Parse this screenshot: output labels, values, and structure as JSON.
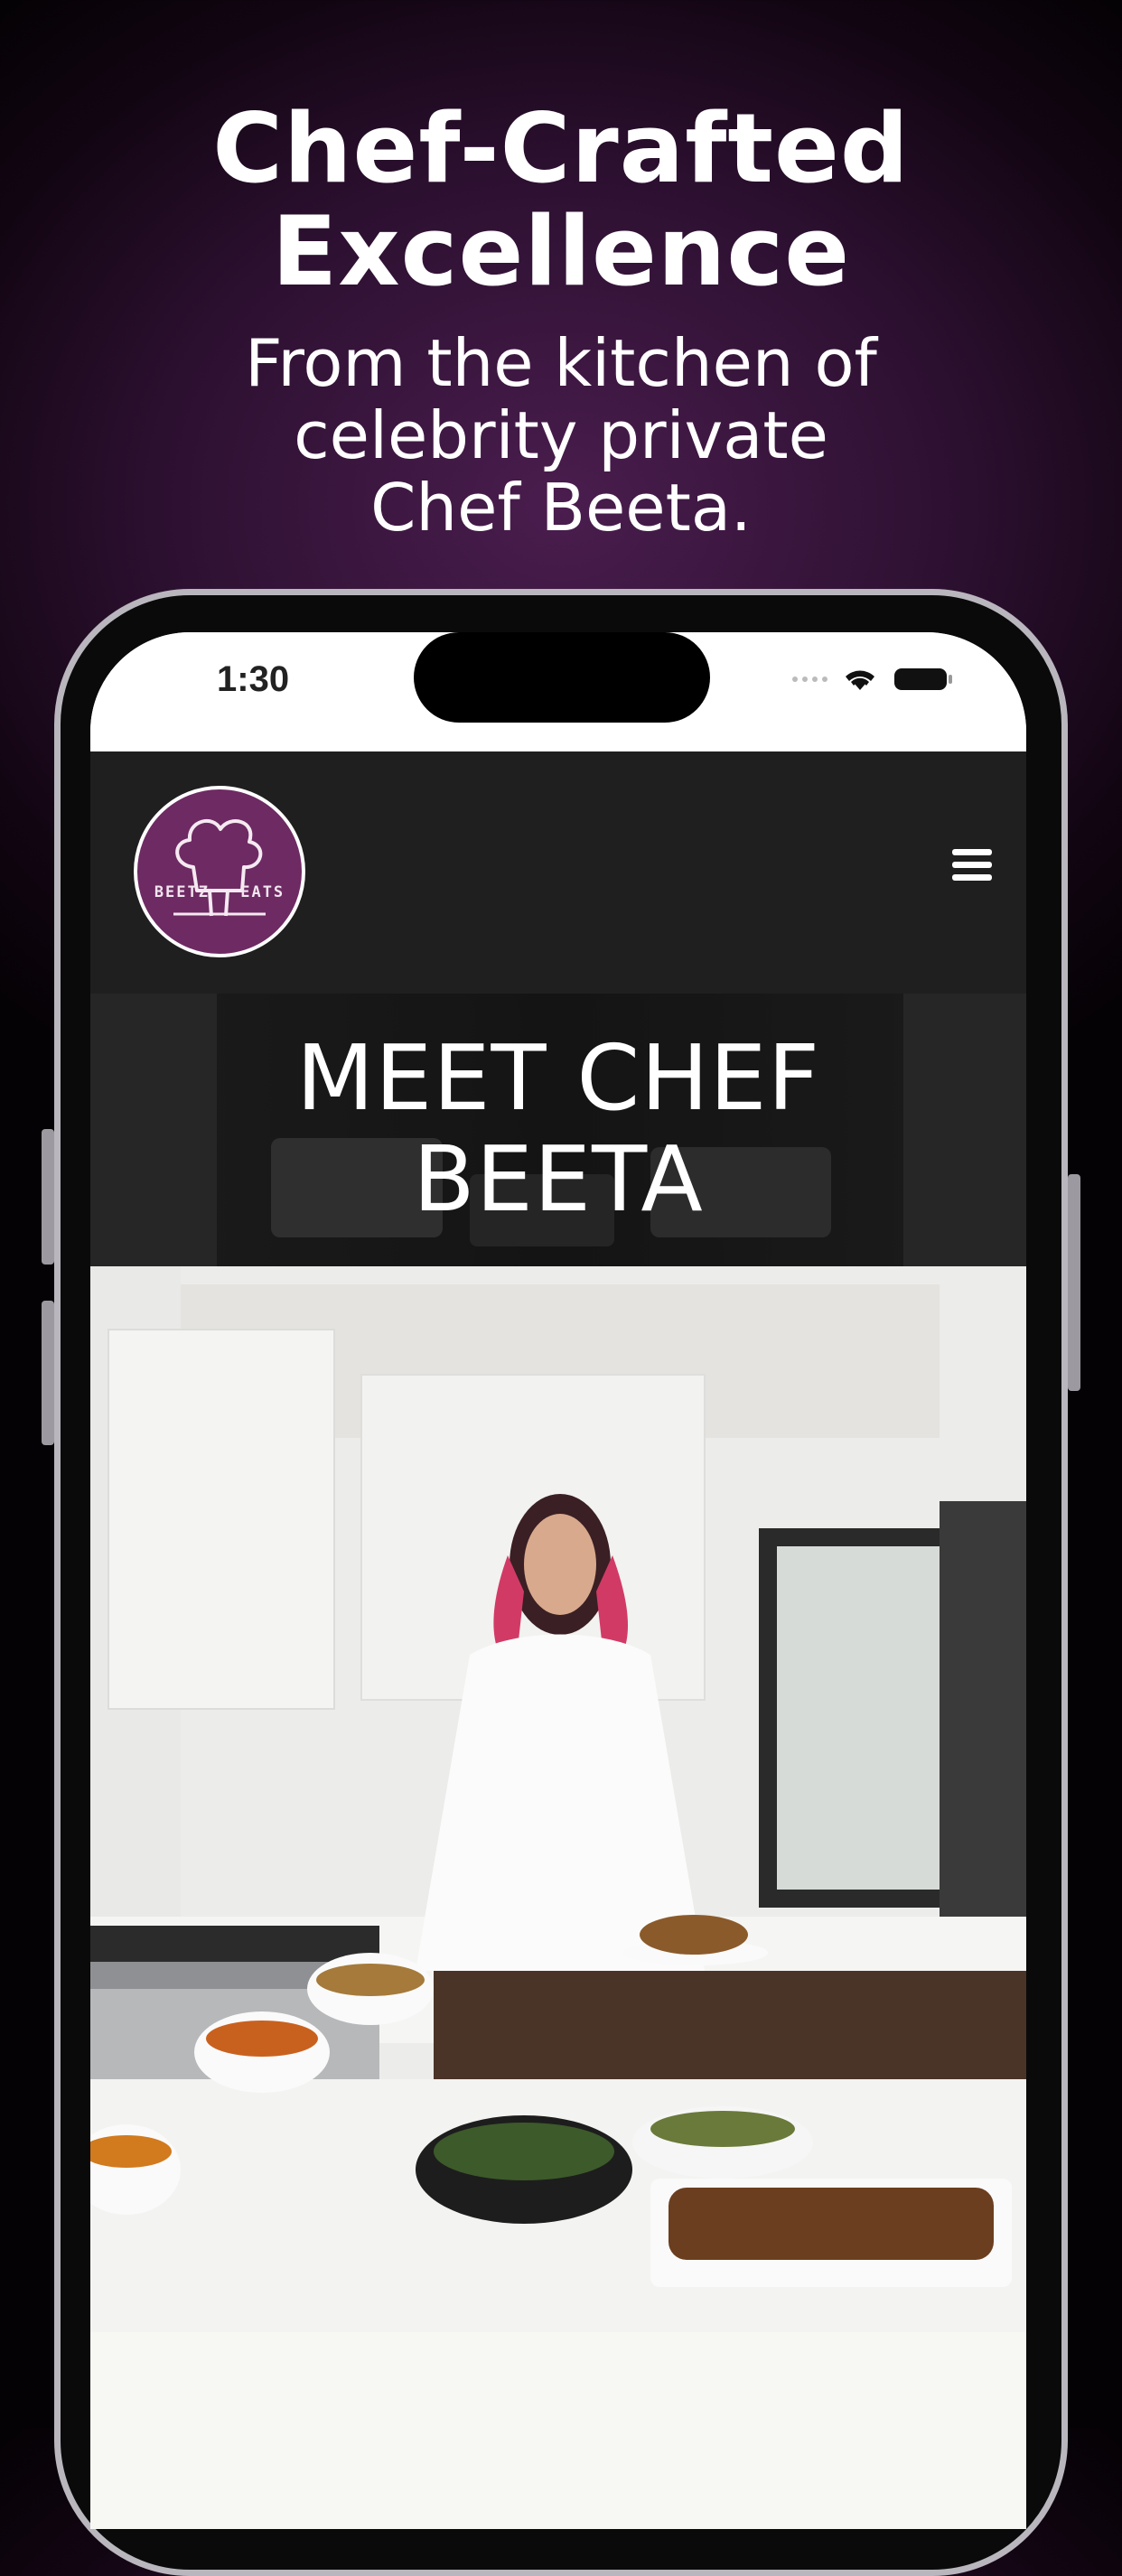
{
  "headline": "Chef-Crafted\nExcellence",
  "subheadline": "From the kitchen of\ncelebrity private\nChef Beeta.",
  "status_bar": {
    "time": "1:30"
  },
  "logo": {
    "text": "BEETZ EATS"
  },
  "banner": {
    "title": "MEET CHEF\nBEETA"
  },
  "colors": {
    "background": "#2c1030",
    "logo_purple": "#6e2a63",
    "navbar": "#1f1f1f"
  }
}
